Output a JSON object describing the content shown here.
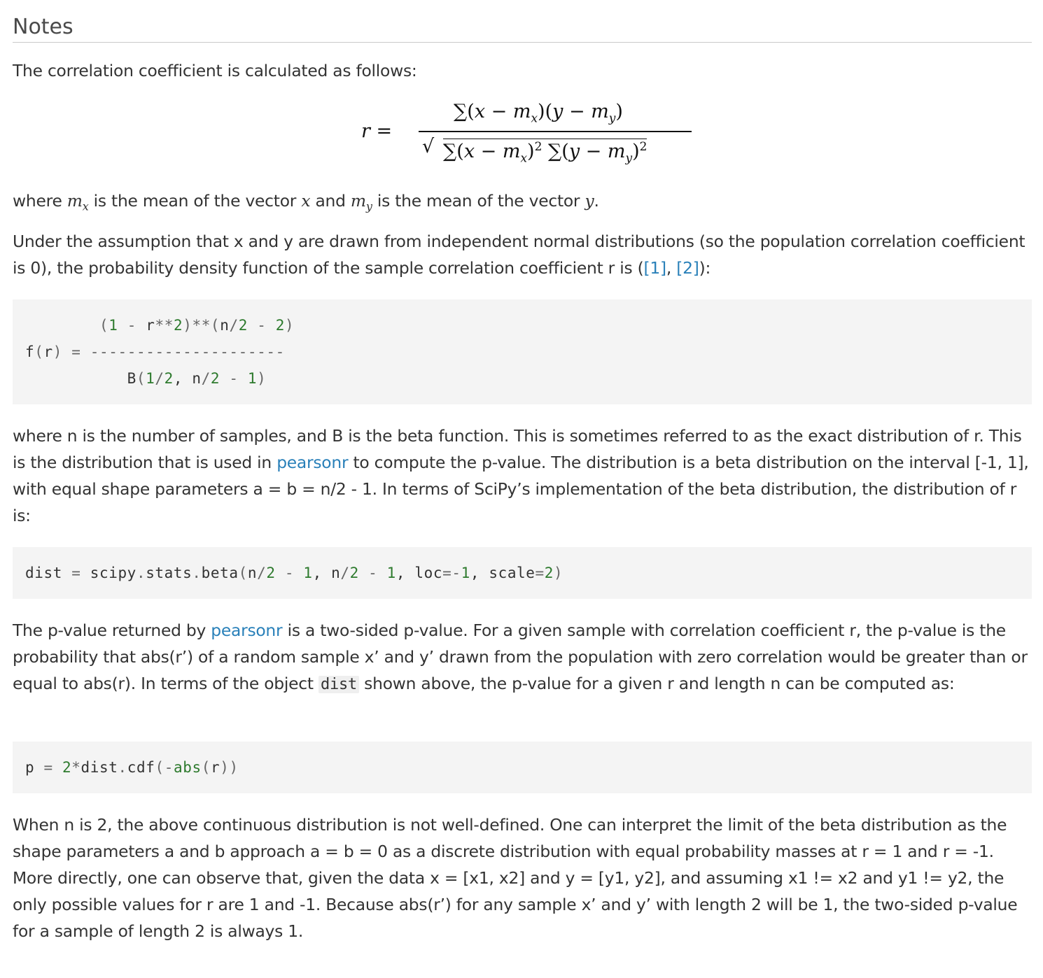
{
  "heading": "Notes",
  "p1": "The correlation coefficient is calculated as follows:",
  "equation": {
    "lhs": "r =",
    "numerator": "∑(x − m",
    "den_part1": "∑(x − m",
    "den_part2": "∑(y − m"
  },
  "p2": {
    "t1": "where ",
    "m1": "m",
    "m1_sub": "x",
    "t2": " is the mean of the vector ",
    "m2": "x",
    "t3": " and ",
    "m3": "m",
    "m3_sub": "y",
    "t4": " is the mean of the vector ",
    "m4": "y",
    "t5": "."
  },
  "p3": {
    "text": "Under the assumption that x and y are drawn from independent normal distributions (so the population correlation coefficient is 0), the probability density function of the sample correlation coefficient r is (",
    "ref1": "[1]",
    "sep": ", ",
    "ref2": "[2]",
    "end": "):"
  },
  "code1": {
    "line1": "        (1 - r**2)**(n/2 - 2)",
    "line2": "f(r) = ---------------------",
    "line3": "           B(1/2, n/2 - 1)"
  },
  "p4": {
    "t1": "where n is the number of samples, and B is the beta function. This is sometimes referred to as the exact distribution of r. This is the distribution that is used in ",
    "link": "pearsonr",
    "t2": " to compute the p-value. The distribution is a beta distribution on the interval [-1, 1], with equal shape parameters a = b = n/2 - 1. In terms of SciPy’s implementation of the beta distribution, the distribution of r is:"
  },
  "code2": {
    "line1": "dist = scipy.stats.beta(n/2 - 1, n/2 - 1, loc=-1, scale=2)"
  },
  "p5": {
    "t1": "The p-value returned by ",
    "link": "pearsonr",
    "t2": " is a two-sided p-value. For a given sample with correlation coefficient r, the p-value is the probability that abs(r’) of a random sample x’ and y’ drawn from the population with zero correlation would be greater than or equal to abs(r). In terms of the object ",
    "code": "dist",
    "t3": " shown above, the p-value for a given r and length n can be computed as:"
  },
  "code3": {
    "line1": "p = 2*dist.cdf(-abs(r))"
  },
  "p6": "When n is 2, the above continuous distribution is not well-defined. One can interpret the limit of the beta distribution as the shape parameters a and b approach a = b = 0 as a discrete distribution with equal probability masses at r = 1 and r = -1. More directly, one can observe that, given the data x = [x1, x2] and y = [y1, y2], and assuming x1 != x2 and y1 != y2, the only possible values for r are 1 and -1. Because abs(r’) for any sample x’ and y’ with length 2 will be 1, the two-sided p-value for a sample of length 2 is always 1.",
  "colors": {
    "link": "#2980b9",
    "code_background": "#f4f4f4",
    "code_number": "#2d7a2d",
    "text": "#333333"
  }
}
